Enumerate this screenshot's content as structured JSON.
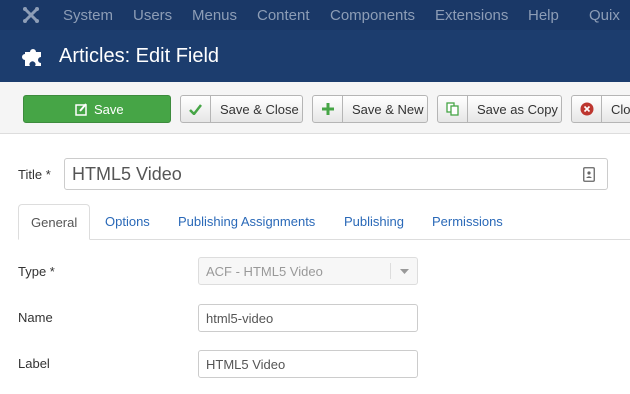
{
  "topbar": {
    "logo_icon": "joomla-logo-icon",
    "items": [
      {
        "label": "System"
      },
      {
        "label": "Users"
      },
      {
        "label": "Menus"
      },
      {
        "label": "Content"
      },
      {
        "label": "Components"
      },
      {
        "label": "Extensions"
      },
      {
        "label": "Help"
      },
      {
        "label": "Quix"
      }
    ]
  },
  "header": {
    "icon": "puzzle-icon",
    "title": "Articles: Edit Field"
  },
  "toolbar": {
    "save_label": "Save",
    "save_close_label": "Save & Close",
    "save_new_label": "Save & New",
    "save_copy_label": "Save as Copy",
    "close_label": "Clo"
  },
  "form": {
    "title_label": "Title *",
    "title_value": "HTML5 Video",
    "tabs": [
      {
        "label": "General"
      },
      {
        "label": "Options"
      },
      {
        "label": "Publishing Assignments"
      },
      {
        "label": "Publishing"
      },
      {
        "label": "Permissions"
      }
    ],
    "type_label": "Type *",
    "type_value": "ACF - HTML5 Video",
    "name_label": "Name",
    "name_value": "html5-video",
    "label_label": "Label",
    "label_value": "HTML5 Video"
  },
  "colors": {
    "topbar_bg": "#1a3867",
    "header_bg": "#1c3d6e",
    "save_green": "#46a546",
    "link_blue": "#2a69b8",
    "close_red": "#bd362f"
  }
}
